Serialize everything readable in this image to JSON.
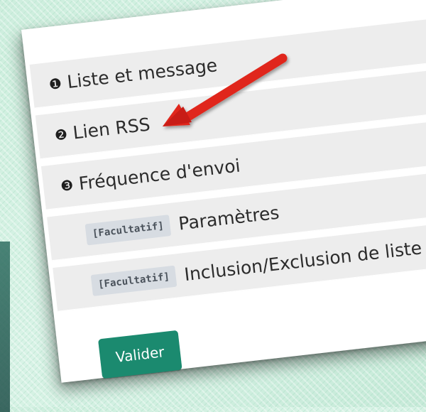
{
  "steps": [
    {
      "number": "❶",
      "label": "Liste et message"
    },
    {
      "number": "❷",
      "label": "Lien RSS"
    },
    {
      "number": "❸",
      "label": "Fréquence d'envoi"
    }
  ],
  "optional_steps": [
    {
      "tag": "[Facultatif]",
      "label": "Paramètres"
    },
    {
      "tag": "[Facultatif]",
      "label": "Inclusion/Exclusion de liste"
    }
  ],
  "submit_label": "Valider",
  "colors": {
    "accent": "#1b8a6f",
    "arrow": "#e0261a",
    "step_bg": "#ededed",
    "tag_bg": "#d7dce2"
  }
}
